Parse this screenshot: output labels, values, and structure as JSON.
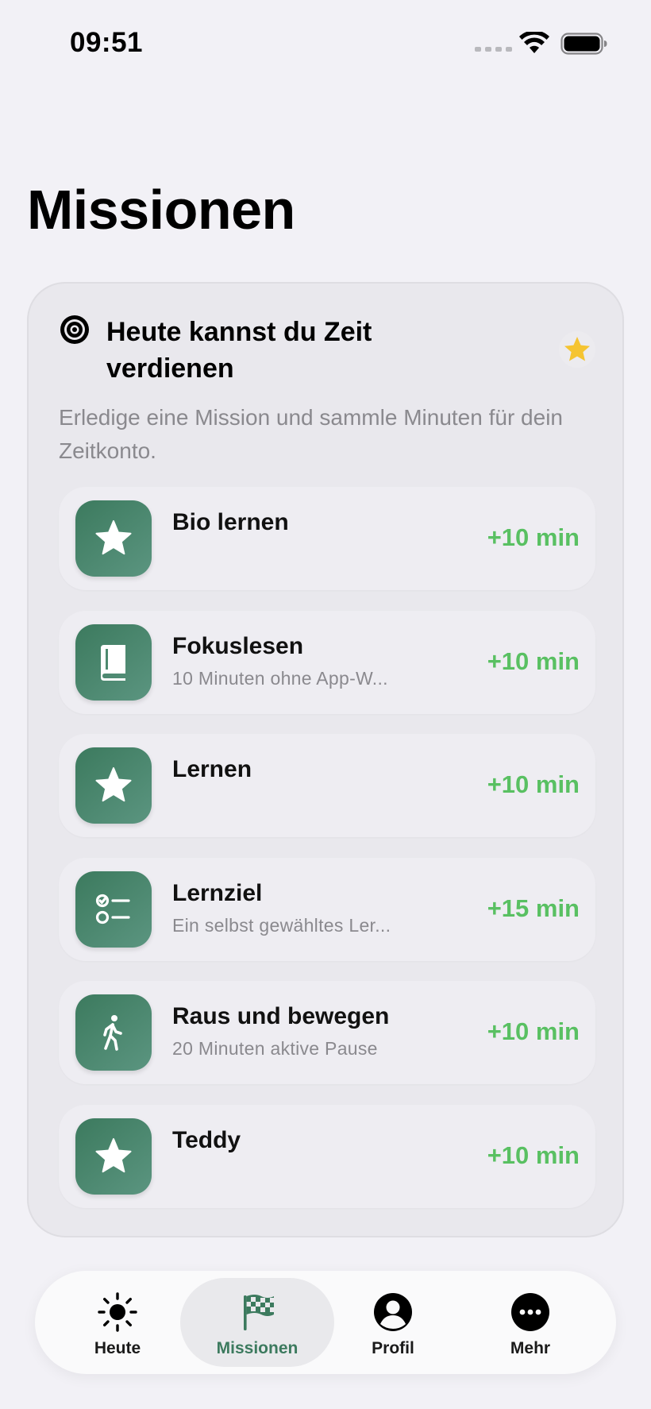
{
  "status_bar": {
    "time": "09:51"
  },
  "page": {
    "title": "Missionen"
  },
  "card": {
    "title": "Heute kannst du Zeit verdienen",
    "subtitle": "Erledige eine Mission und sammle Minuten für dein Zeitkonto.",
    "header_icon": "target-icon",
    "accent_icon": "star-icon",
    "accent_color": "#f5c431"
  },
  "missions": [
    {
      "name": "Bio lernen",
      "description": "",
      "reward": "+10 min",
      "icon": "star-icon"
    },
    {
      "name": "Fokuslesen",
      "description": "10 Minuten ohne App-W...",
      "reward": "+10 min",
      "icon": "book-icon"
    },
    {
      "name": "Lernen",
      "description": "",
      "reward": "+10 min",
      "icon": "star-icon"
    },
    {
      "name": "Lernziel",
      "description": "Ein selbst gewähltes Ler...",
      "reward": "+15 min",
      "icon": "checklist-icon"
    },
    {
      "name": "Raus und bewegen",
      "description": "20 Minuten aktive Pause",
      "reward": "+10 min",
      "icon": "walking-icon"
    },
    {
      "name": "Teddy",
      "description": "",
      "reward": "+10 min",
      "icon": "star-icon"
    }
  ],
  "tabs": [
    {
      "label": "Heute",
      "icon": "sun-icon",
      "active": false
    },
    {
      "label": "Missionen",
      "icon": "checkered-flag-icon",
      "active": true
    },
    {
      "label": "Profil",
      "icon": "person-icon",
      "active": false
    },
    {
      "label": "Mehr",
      "icon": "ellipsis-icon",
      "active": false
    }
  ],
  "colors": {
    "accent_green": "#3c7a5e",
    "reward_green": "#59c062",
    "background": "#f2f1f6"
  }
}
